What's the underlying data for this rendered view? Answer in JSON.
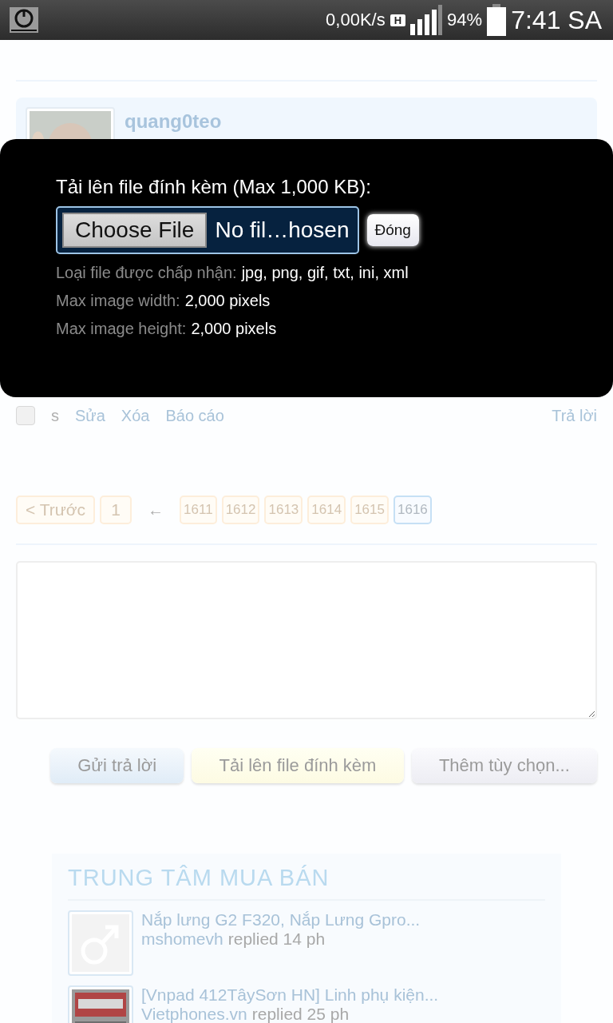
{
  "status_bar": {
    "net_speed": "0,00K/s",
    "network_type": "H",
    "battery": "94%",
    "time": "7:41 SA"
  },
  "post": {
    "username": "quang0teo",
    "checked": false,
    "actions": [
      {
        "label": "s",
        "disabled": true
      },
      {
        "label": "Sửa",
        "disabled": false
      },
      {
        "label": "Xóa",
        "disabled": false
      },
      {
        "label": "Báo cáo",
        "disabled": false
      }
    ],
    "reply": "Trả lời"
  },
  "pagination": {
    "prev": "< Trước",
    "first": "1",
    "arrow": "←",
    "pages": [
      {
        "label": "1611",
        "selected": false
      },
      {
        "label": "1612",
        "selected": false
      },
      {
        "label": "1613",
        "selected": false
      },
      {
        "label": "1614",
        "selected": false
      },
      {
        "label": "1615",
        "selected": false
      },
      {
        "label": "1616",
        "selected": true
      }
    ]
  },
  "reply_buttons": [
    {
      "label": "Gửi trả lời",
      "kind": "submit"
    },
    {
      "label": "Tải lên file đính kèm",
      "kind": "upload"
    },
    {
      "label": "Thêm tùy chọn...",
      "kind": "more"
    }
  ],
  "sidebar": {
    "title": "TRUNG TÂM MUA BÁN",
    "threads": [
      {
        "title": "Nắp lưng G2 F320, Nắp Lưng Gpro...",
        "user": "mshomevh",
        "meta": "replied 14 ph",
        "kind": "icon"
      },
      {
        "title": "[Vnpad 412TâySơn HN] Linh phụ kiện...",
        "user": "Vietphones.vn",
        "meta": "replied 25 ph",
        "kind": "picture"
      }
    ]
  },
  "modal": {
    "title": "Tải lên file đính kèm (Max 1,000 KB):",
    "file_button": "Choose File",
    "file_value": "No fil…hosen",
    "close": "Đóng",
    "info": [
      {
        "label": "Loại file được chấp nhận:",
        "value": "jpg, png, gif, txt, ini, xml"
      },
      {
        "label": "Max image width:",
        "value": "2,000 pixels"
      },
      {
        "label": "Max image height:",
        "value": "2,000 pixels"
      }
    ]
  }
}
